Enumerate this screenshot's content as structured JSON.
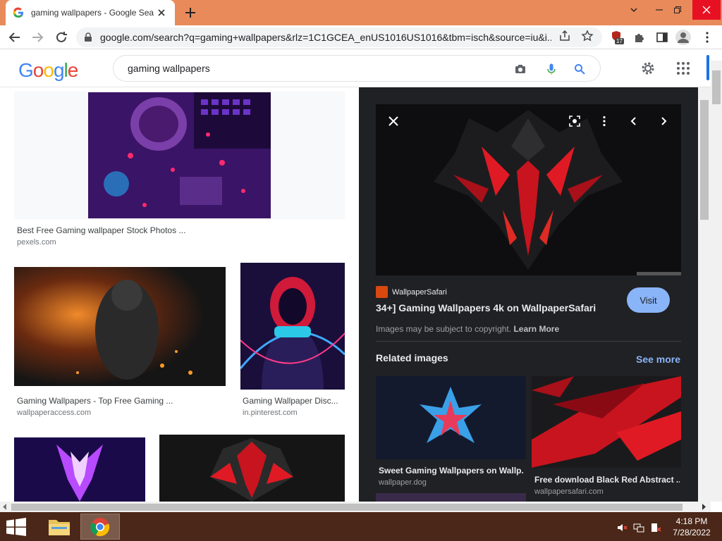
{
  "browser": {
    "tab_title": "gaming wallpapers - Google Sea",
    "url": "google.com/search?q=gaming+wallpapers&rlz=1C1GCEA_enUS1016US1016&tbm=isch&source=iu&i...",
    "extension_badge": "17"
  },
  "google": {
    "logo": [
      "G",
      "o",
      "o",
      "g",
      "l",
      "e"
    ],
    "logo_colors": [
      "#4285f4",
      "#ea4335",
      "#fbbc05",
      "#4285f4",
      "#34a853",
      "#ea4335"
    ],
    "search_query": "gaming wallpapers"
  },
  "results": [
    {
      "title": "Best Free Gaming wallpaper Stock Photos ...",
      "source": "pexels.com"
    },
    {
      "title": "Gaming Wallpapers - Top Free Gaming ...",
      "source": "wallpaperaccess.com"
    },
    {
      "title": "Gaming Wallpaper Disc...",
      "source": "in.pinterest.com"
    }
  ],
  "preview": {
    "site_name": "WallpaperSafari",
    "title": "34+] Gaming Wallpapers 4k on WallpaperSafari",
    "visit_label": "Visit",
    "copyright_text": "Images may be subject to copyright.",
    "learn_more": "Learn More",
    "related_heading": "Related images",
    "see_more": "See more",
    "related": [
      {
        "title": "Sweet Gaming Wallpapers on Wallp...",
        "source": "wallpaper.dog"
      },
      {
        "title": "Free download Black Red Abstract ...",
        "source": "wallpapersafari.com"
      }
    ]
  },
  "taskbar": {
    "time": "4:18 PM",
    "date": "7/28/2022"
  },
  "colors": {
    "accent": "#1a73e8",
    "visit": "#8ab4f8",
    "panel_bg": "#202124",
    "titlebar": "#e98a5b"
  }
}
